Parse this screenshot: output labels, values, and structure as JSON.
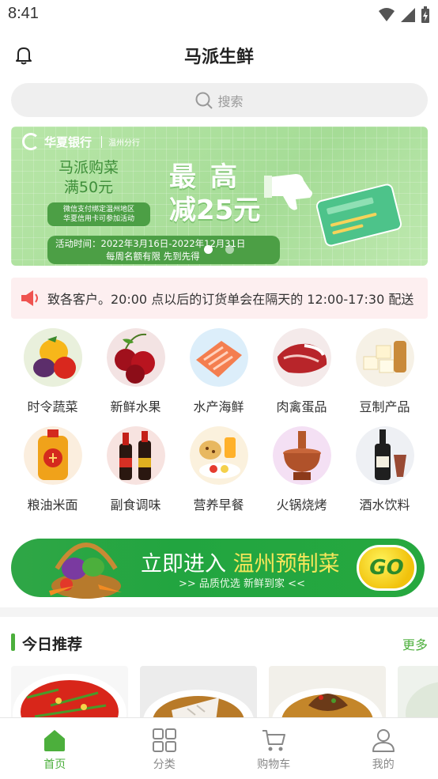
{
  "status_bar": {
    "time": "8:41"
  },
  "header": {
    "title": "马派生鲜"
  },
  "search": {
    "placeholder": "搜索"
  },
  "banner": {
    "bank_name": "华夏银行",
    "bank_branch": "温州分行",
    "promo_line1": "马派购菜",
    "promo_line2": "满50元",
    "tag_line1": "微信支付绑定温州地区",
    "tag_line2": "华夏信用卡可参加活动",
    "big_line1": "最高",
    "big_line2": "减25元",
    "activity_line1": "活动时间：2022年3月16日-2022年12月31日",
    "activity_line2": "每周名额有限 先到先得",
    "slide_count": 2,
    "active_slide": 0
  },
  "notice": {
    "text": "致各客户。20:00 点以后的订货单会在隔天的 12:00-17:30 配送"
  },
  "categories": [
    {
      "label": "时令蔬菜",
      "icon": "vegetables-icon"
    },
    {
      "label": "新鲜水果",
      "icon": "cherries-icon"
    },
    {
      "label": "水产海鲜",
      "icon": "salmon-icon"
    },
    {
      "label": "肉禽蛋品",
      "icon": "meat-icon"
    },
    {
      "label": "豆制产品",
      "icon": "tofu-icon"
    },
    {
      "label": "粮油米面",
      "icon": "oil-icon"
    },
    {
      "label": "副食调味",
      "icon": "soy-sauce-icon"
    },
    {
      "label": "营养早餐",
      "icon": "breakfast-icon"
    },
    {
      "label": "火锅烧烤",
      "icon": "hotpot-icon"
    },
    {
      "label": "酒水饮料",
      "icon": "wine-icon"
    }
  ],
  "promo_bar": {
    "main_prefix": "立即进入",
    "main_highlight": "温州预制菜",
    "sub": ">> 品质优选  新鲜到家 <<",
    "go_label": "GO"
  },
  "recommend": {
    "title": "今日推荐",
    "more": "更多"
  },
  "tabbar": {
    "items": [
      {
        "label": "首页",
        "icon": "home-icon",
        "active": true
      },
      {
        "label": "分类",
        "icon": "grid-icon",
        "active": false
      },
      {
        "label": "购物车",
        "icon": "cart-icon",
        "active": false
      },
      {
        "label": "我的",
        "icon": "user-icon",
        "active": false
      }
    ]
  },
  "colors": {
    "accent": "#4caf3c",
    "notice_bg": "#fdeff0",
    "banner_green": "#a5dc96"
  }
}
